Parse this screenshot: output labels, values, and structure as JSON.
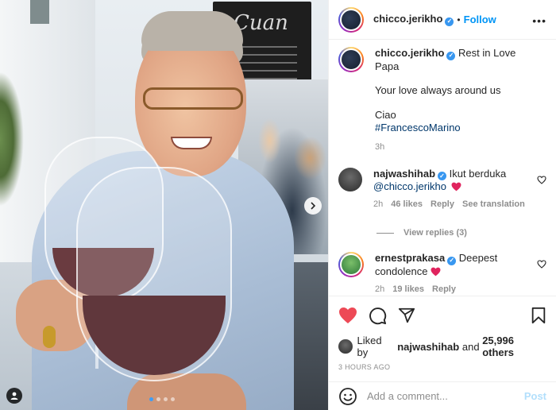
{
  "post": {
    "username": "chicco.jerikho",
    "follow_label": "Follow",
    "separator": "•",
    "more_label": "•••"
  },
  "caption": {
    "username": "chicco.jerikho",
    "line1": "Rest in Love Papa",
    "line2": "Your love always around us",
    "line3": "Ciao",
    "hashtag": "#FrancescoMarino",
    "time": "3h"
  },
  "comments": [
    {
      "username": "najwashihab",
      "text": "Ikut berduka",
      "mention": "@chicco.jerikho",
      "time": "2h",
      "likes": "46 likes",
      "reply": "Reply",
      "translate": "See translation",
      "view_replies": "View replies (3)"
    },
    {
      "username": "ernestprakasa",
      "text": "Deepest",
      "text2": "condolence",
      "time": "2h",
      "likes": "19 likes",
      "reply": "Reply"
    }
  ],
  "likes": {
    "prefix": "Liked by",
    "user": "najwashihab",
    "and": "and",
    "count": "25,996 others"
  },
  "timestamp": "3 HOURS AGO",
  "add_comment": {
    "placeholder": "Add a comment...",
    "post_label": "Post"
  },
  "photo": {
    "sign_text": "Cuan"
  },
  "carousel": {
    "dots": 4,
    "active": 0
  },
  "colors": {
    "accent": "#0095f6",
    "verified": "#3897f0",
    "like_red": "#ed4956",
    "post_disabled": "#b2dffc"
  },
  "icons": {
    "verified": "verified-badge-icon",
    "heart": "heart-icon",
    "comment": "comment-icon",
    "share": "share-icon",
    "save": "bookmark-icon",
    "emoji": "smiley-icon",
    "next": "chevron-right-icon",
    "tag": "user-tag-icon"
  }
}
